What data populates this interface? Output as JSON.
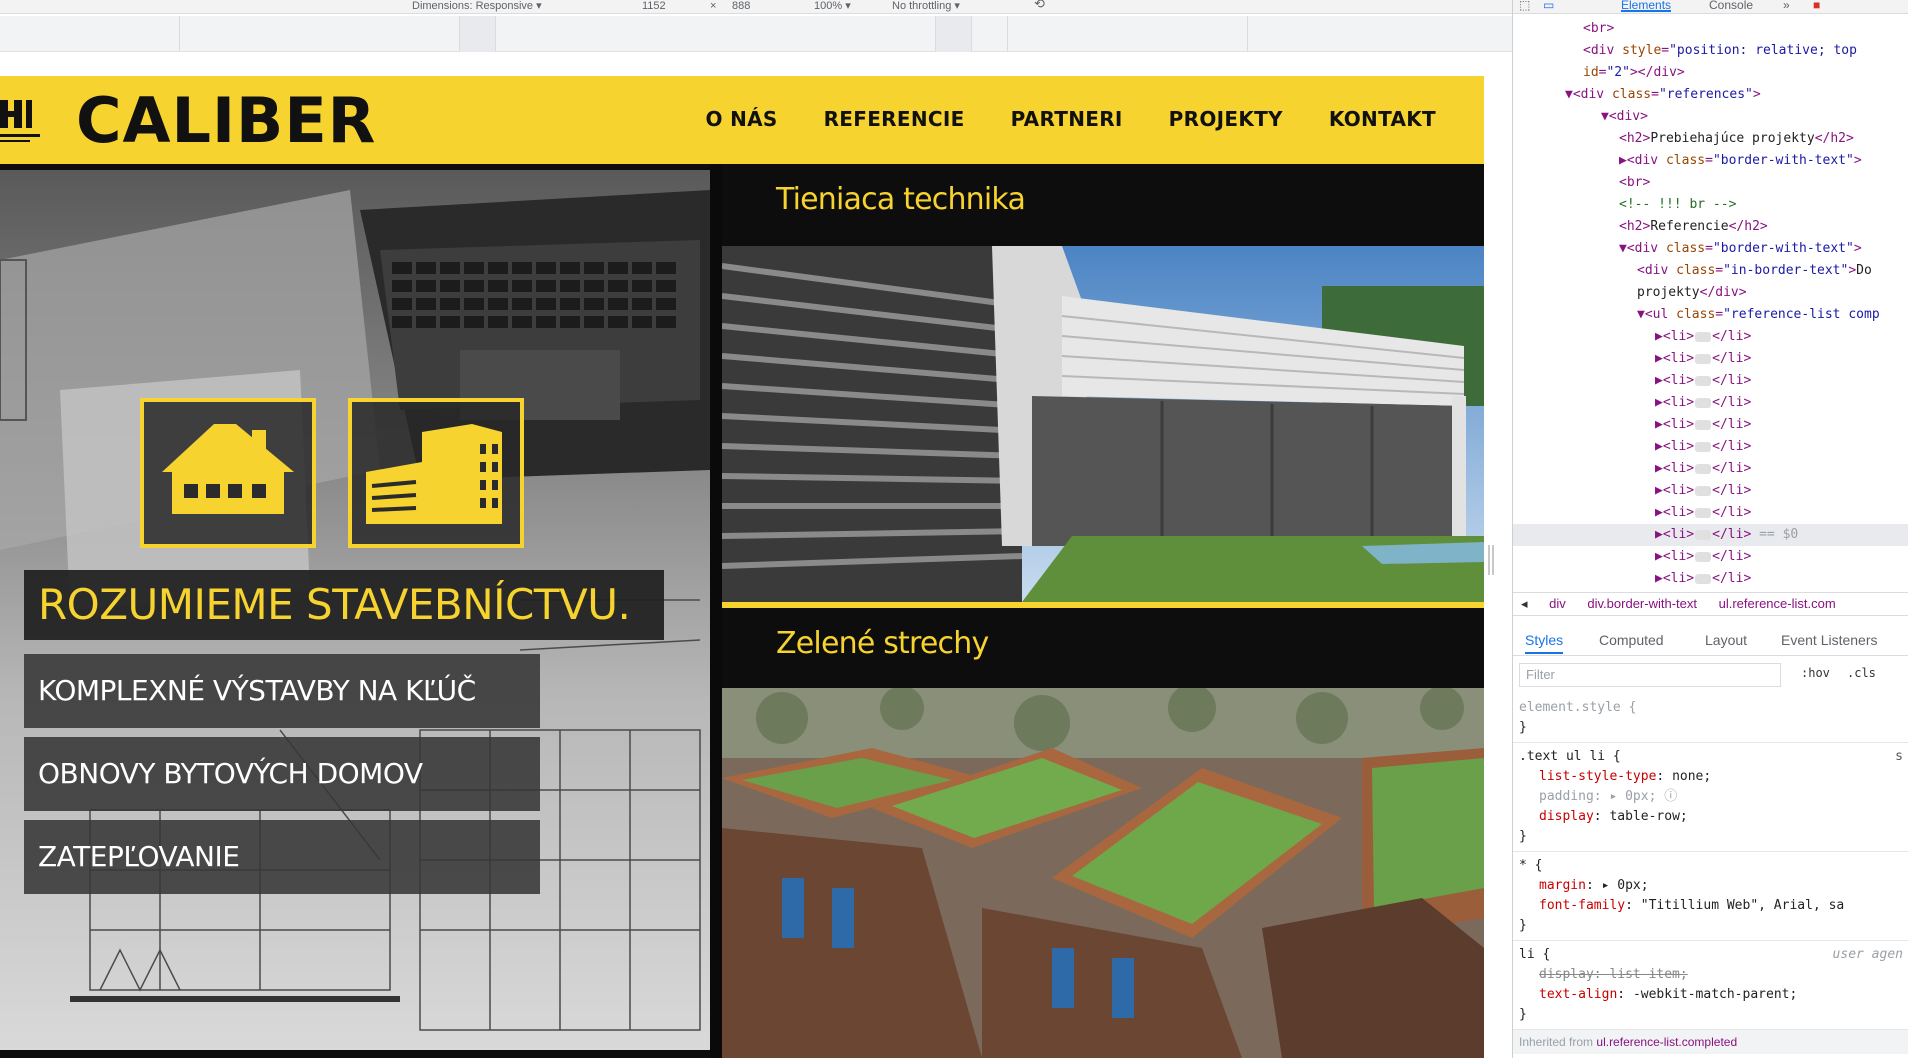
{
  "device_toolbar": {
    "dimensions_label": "Dimensions: Responsive ▾",
    "width_value": "1152",
    "times": "×",
    "height_value": "888",
    "zoom": "100% ▾",
    "throttling": "No throttling ▾"
  },
  "site": {
    "logo_text": "CALIBER",
    "nav": [
      "O NÁS",
      "REFERENCIE",
      "PARTNERI",
      "PROJEKTY",
      "KONTAKT"
    ],
    "slogan": "ROZUMIEME STAVEBNÍCTVU.",
    "services": [
      "KOMPLEXNÉ VÝSTAVBY NA KĽÚČ",
      "OBNOVY BYTOVÝCH DOMOV",
      "ZATEPĽOVANIE"
    ],
    "categories": [
      "Tieniaca technika",
      "Zelené strechy"
    ],
    "accent_color": "#f6d32e"
  },
  "devtools": {
    "tabs": [
      "Elements",
      "Console",
      "»"
    ],
    "dom_lines": [
      {
        "indent": 0,
        "html": "<span class='tag'>&lt;br&gt;</span>"
      },
      {
        "indent": 0,
        "html": "<span class='tag'>&lt;div </span><span class='attr'>style</span>=<span class='val'>\"position: relative; top</span>"
      },
      {
        "indent": 0,
        "html": "<span class='attr'>id</span>=<span class='val'>\"2\"</span><span class='tag'>&gt;&lt;/div&gt;</span>"
      },
      {
        "indent": -1,
        "html": "▼<span class='tag'>&lt;div </span><span class='attr'>class</span>=<span class='val'>\"references\"</span><span class='tag'>&gt;</span>"
      },
      {
        "indent": 1,
        "html": "▼<span class='tag'>&lt;div&gt;</span>"
      },
      {
        "indent": 2,
        "html": "<span class='tag'>&lt;h2&gt;</span><span class='txt'>Prebiehajúce projekty</span><span class='tag'>&lt;/h2&gt;</span>"
      },
      {
        "indent": 2,
        "html": "▶<span class='tag'>&lt;div </span><span class='attr'>class</span>=<span class='val'>\"border-with-text\"</span><span class='tag'>&gt;</span>"
      },
      {
        "indent": 2,
        "html": "<span class='tag'>&lt;br&gt;</span>"
      },
      {
        "indent": 2,
        "html": "<span class='cmt'>&lt;!-- !!! br --&gt;</span>"
      },
      {
        "indent": 2,
        "html": "<span class='tag'>&lt;h2&gt;</span><span class='txt'>Referencie</span><span class='tag'>&lt;/h2&gt;</span>"
      },
      {
        "indent": 2,
        "html": "▼<span class='tag'>&lt;div </span><span class='attr'>class</span>=<span class='val'>\"border-with-text\"</span><span class='tag'>&gt;</span>"
      },
      {
        "indent": 3,
        "html": "<span class='tag'>&lt;div </span><span class='attr'>class</span>=<span class='val'>\"in-border-text\"</span><span class='tag'>&gt;</span><span class='txt'>Do</span>"
      },
      {
        "indent": 3,
        "html": "<span class='txt'>projekty</span><span class='tag'>&lt;/div&gt;</span>"
      },
      {
        "indent": 3,
        "html": "▼<span class='tag'>&lt;ul </span><span class='attr'>class</span>=<span class='val'>\"reference-list comp</span>"
      },
      {
        "indent": 4,
        "html": "▶<span class='tag'>&lt;li&gt;</span><span class='ellipsis'></span><span class='tag'>&lt;/li&gt;</span>"
      },
      {
        "indent": 4,
        "html": "▶<span class='tag'>&lt;li&gt;</span><span class='ellipsis'></span><span class='tag'>&lt;/li&gt;</span>"
      },
      {
        "indent": 4,
        "html": "▶<span class='tag'>&lt;li&gt;</span><span class='ellipsis'></span><span class='tag'>&lt;/li&gt;</span>"
      },
      {
        "indent": 4,
        "html": "▶<span class='tag'>&lt;li&gt;</span><span class='ellipsis'></span><span class='tag'>&lt;/li&gt;</span>"
      },
      {
        "indent": 4,
        "html": "▶<span class='tag'>&lt;li&gt;</span><span class='ellipsis'></span><span class='tag'>&lt;/li&gt;</span>"
      },
      {
        "indent": 4,
        "html": "▶<span class='tag'>&lt;li&gt;</span><span class='ellipsis'></span><span class='tag'>&lt;/li&gt;</span>"
      },
      {
        "indent": 4,
        "html": "▶<span class='tag'>&lt;li&gt;</span><span class='ellipsis'></span><span class='tag'>&lt;/li&gt;</span>"
      },
      {
        "indent": 4,
        "html": "▶<span class='tag'>&lt;li&gt;</span><span class='ellipsis'></span><span class='tag'>&lt;/li&gt;</span>"
      },
      {
        "indent": 4,
        "html": "▶<span class='tag'>&lt;li&gt;</span><span class='ellipsis'></span><span class='tag'>&lt;/li&gt;</span>"
      },
      {
        "indent": 4,
        "html": "▶<span class='tag'>&lt;li&gt;</span><span class='ellipsis'></span><span class='tag'>&lt;/li&gt;</span> <span class='dim'>== $0</span>",
        "highlight": true
      },
      {
        "indent": 4,
        "html": "▶<span class='tag'>&lt;li&gt;</span><span class='ellipsis'></span><span class='tag'>&lt;/li&gt;</span>"
      },
      {
        "indent": 4,
        "html": "▶<span class='tag'>&lt;li&gt;</span><span class='ellipsis'></span><span class='tag'>&lt;/li&gt;</span>"
      }
    ],
    "breadcrumbs": [
      "div",
      "div.border-with-text",
      "ul.reference-list.com"
    ],
    "pane_tabs": [
      "Styles",
      "Computed",
      "Layout",
      "Event Listeners"
    ],
    "filter_placeholder": "Filter",
    "hov": ":hov",
    "cls": ".cls",
    "inherited_label": "Inherited from",
    "inherited_selector": "ul.reference-list.completed"
  }
}
